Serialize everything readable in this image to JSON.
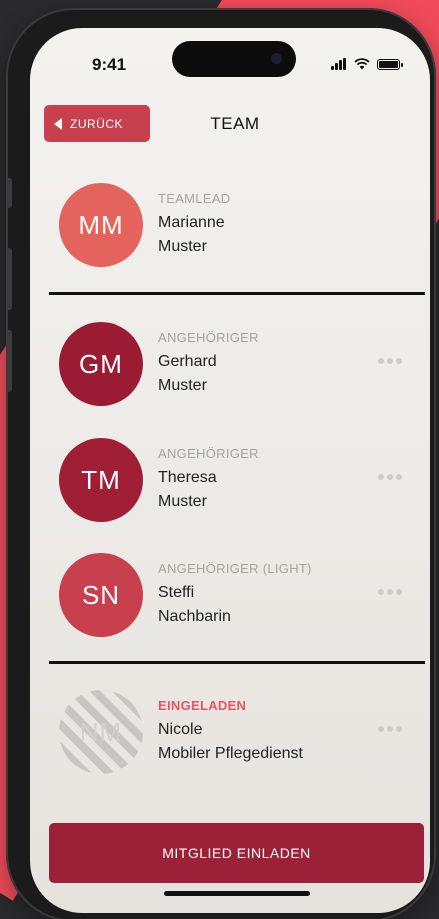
{
  "status_bar": {
    "time": "9:41"
  },
  "header": {
    "back_label": "ZURÜCK",
    "title": "TEAM"
  },
  "lead": {
    "initials": "MM",
    "role": "TEAMLEAD",
    "first_name": "Marianne",
    "last_name": "Muster",
    "color": "#e4635d"
  },
  "members": [
    {
      "initials": "GM",
      "role": "ANGEHÖRIGER",
      "first_name": "Gerhard",
      "last_name": "Muster",
      "color": "#9b1b35"
    },
    {
      "initials": "TM",
      "role": "ANGEHÖRIGER",
      "first_name": "Theresa",
      "last_name": "Muster",
      "color": "#a01f36"
    },
    {
      "initials": "SN",
      "role": "ANGEHÖRIGER (LIGHT)",
      "first_name": "Steffi",
      "last_name": "Nachbarin",
      "color": "#c8404d"
    }
  ],
  "invited": {
    "initials": "NM",
    "status": "EINGELADEN",
    "first_name": "Nicole",
    "last_name": "Mobiler Pflegedienst"
  },
  "actions": {
    "invite_label": "MITGLIED EINLADEN"
  },
  "icons": {
    "back": "chevron-left-icon",
    "more": "more-dots-icon",
    "signal": "signal-icon",
    "wifi": "wifi-icon",
    "battery": "battery-icon"
  }
}
